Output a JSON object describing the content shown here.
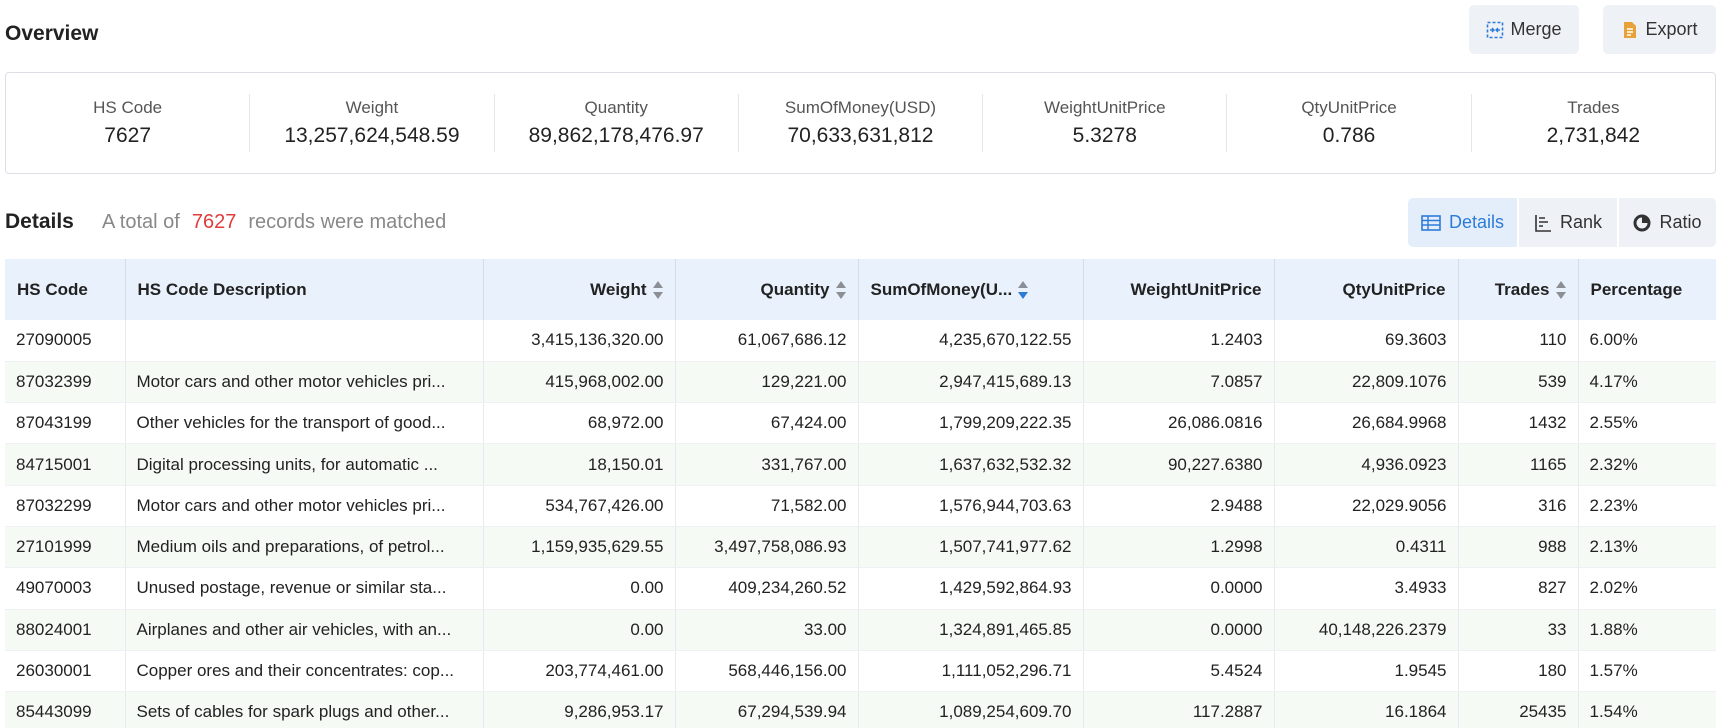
{
  "header": {
    "title": "Overview",
    "merge_label": "Merge",
    "export_label": "Export"
  },
  "summary": [
    {
      "label": "HS Code",
      "value": "7627"
    },
    {
      "label": "Weight",
      "value": "13,257,624,548.59"
    },
    {
      "label": "Quantity",
      "value": "89,862,178,476.97"
    },
    {
      "label": "SumOfMoney(USD)",
      "value": "70,633,631,812"
    },
    {
      "label": "WeightUnitPrice",
      "value": "5.3278"
    },
    {
      "label": "QtyUnitPrice",
      "value": "0.786"
    },
    {
      "label": "Trades",
      "value": "2,731,842"
    }
  ],
  "details": {
    "title": "Details",
    "prefix": "A total of",
    "count": "7627",
    "suffix": "records were matched",
    "views": {
      "details": "Details",
      "rank": "Rank",
      "ratio": "Ratio"
    }
  },
  "table": {
    "columns": [
      "HS Code",
      "HS Code Description",
      "Weight",
      "Quantity",
      "SumOfMoney(U...",
      "WeightUnitPrice",
      "QtyUnitPrice",
      "Trades",
      "Percentage"
    ],
    "rows": [
      [
        "27090005",
        "",
        "3,415,136,320.00",
        "61,067,686.12",
        "4,235,670,122.55",
        "1.2403",
        "69.3603",
        "110",
        "6.00%"
      ],
      [
        "87032399",
        "Motor cars and other motor vehicles pri...",
        "415,968,002.00",
        "129,221.00",
        "2,947,415,689.13",
        "7.0857",
        "22,809.1076",
        "539",
        "4.17%"
      ],
      [
        "87043199",
        "Other vehicles for the transport of good...",
        "68,972.00",
        "67,424.00",
        "1,799,209,222.35",
        "26,086.0816",
        "26,684.9968",
        "1432",
        "2.55%"
      ],
      [
        "84715001",
        "Digital processing units, for automatic ...",
        "18,150.01",
        "331,767.00",
        "1,637,632,532.32",
        "90,227.6380",
        "4,936.0923",
        "1165",
        "2.32%"
      ],
      [
        "87032299",
        "Motor cars and other motor vehicles pri...",
        "534,767,426.00",
        "71,582.00",
        "1,576,944,703.63",
        "2.9488",
        "22,029.9056",
        "316",
        "2.23%"
      ],
      [
        "27101999",
        "Medium oils and preparations, of petrol...",
        "1,159,935,629.55",
        "3,497,758,086.93",
        "1,507,741,977.62",
        "1.2998",
        "0.4311",
        "988",
        "2.13%"
      ],
      [
        "49070003",
        "Unused postage, revenue or similar sta...",
        "0.00",
        "409,234,260.52",
        "1,429,592,864.93",
        "0.0000",
        "3.4933",
        "827",
        "2.02%"
      ],
      [
        "88024001",
        "Airplanes and other air vehicles, with an...",
        "0.00",
        "33.00",
        "1,324,891,465.85",
        "0.0000",
        "40,148,226.2379",
        "33",
        "1.88%"
      ],
      [
        "26030001",
        "Copper ores and their concentrates: cop...",
        "203,774,461.00",
        "568,446,156.00",
        "1,111,052,296.71",
        "5.4524",
        "1.9545",
        "180",
        "1.57%"
      ],
      [
        "85443099",
        "Sets of cables for spark plugs and other...",
        "9,286,953.17",
        "67,294,539.94",
        "1,089,254,609.70",
        "117.2887",
        "16.1864",
        "25435",
        "1.54%"
      ]
    ]
  },
  "colors": {
    "accent": "#2d7bd9",
    "count": "#e03c3c",
    "header_bg": "#e9f1fc",
    "row_alt": "#f5faf5"
  }
}
